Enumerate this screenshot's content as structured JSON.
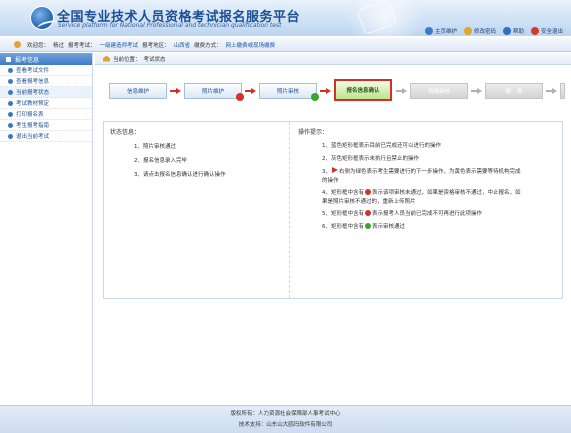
{
  "header": {
    "title_cn": "全国专业技术人员资格考试报名服务平台",
    "title_en": "Service platform for National Professional and technician qualification test",
    "links": [
      {
        "label": "主页维护",
        "icon": "home-icon"
      },
      {
        "label": "修改密码",
        "icon": "key-icon"
      },
      {
        "label": "帮助",
        "icon": "help-icon"
      },
      {
        "label": "安全退出",
        "icon": "exit-icon"
      }
    ]
  },
  "infobar": {
    "welcome_label": "欢迎您：",
    "user": "杨过",
    "exam_label": "报考考试：",
    "exam": "一级建造师考试",
    "region_label": "报考地区：",
    "region": "山西省",
    "pay_label": "缴费方式：",
    "pay": "网上缴费或现场缴费"
  },
  "sidebar": {
    "title": "报考信息",
    "items": [
      {
        "label": "查看考试文件"
      },
      {
        "label": "查看报考信息"
      },
      {
        "label": "当前报考状态"
      },
      {
        "label": "考试教材预定"
      },
      {
        "label": "打印报名表"
      },
      {
        "label": "考生报考指南"
      },
      {
        "label": "退出当前考试"
      }
    ]
  },
  "breadcrumb": {
    "prefix": "当前位置：",
    "current": "考试状态"
  },
  "steps": [
    {
      "label": "信息维护",
      "state": "normal"
    },
    {
      "label": "照片维护",
      "state": "normal",
      "badge": "red"
    },
    {
      "label": "照片审核",
      "state": "normal",
      "badge": "green"
    },
    {
      "label": "报名信息确认",
      "state": "current"
    },
    {
      "label": "资格审核",
      "state": "disabled"
    },
    {
      "label": "缴　费",
      "state": "disabled"
    },
    {
      "label": "报名完成",
      "state": "disabled"
    }
  ],
  "status_panel": {
    "title": "状态信息：",
    "lines": [
      "1、照片审核通过",
      "2、报名信息录入完毕",
      "3、请点击报名信息确认进行确认操作"
    ]
  },
  "tips_panel": {
    "title": "操作提示：",
    "tip1": "1、蓝色矩形框表示目前已完成还可以进行的操作",
    "tip2": "2、灰色矩形框表示未执行且禁止的操作",
    "tip3_a": "3、",
    "tip3_b": "右侧为绿色表示考生需要进行的下一步操作，为黄色表示需要等待机构完成",
    "tip3_c": "的操作",
    "tip4_a": "4、矩形框中含有",
    "tip4_b": "表示该项审核未通过，如果是资格审核不通过，中止报名，如",
    "tip4_c": "果是照片审核不通过的，重新上传照片",
    "tip5_a": "5、矩形框中含有",
    "tip5_b": "表示报考人员当前已完成不可再进行此项操作",
    "tip6_a": "6、矩形框中含有",
    "tip6_b": "表示审核通过"
  },
  "footer": {
    "copyright": "版权所有：人力资源社会保障部人事考试中心",
    "support": "技术支持：山东山大鸥玛软件有限公司"
  }
}
